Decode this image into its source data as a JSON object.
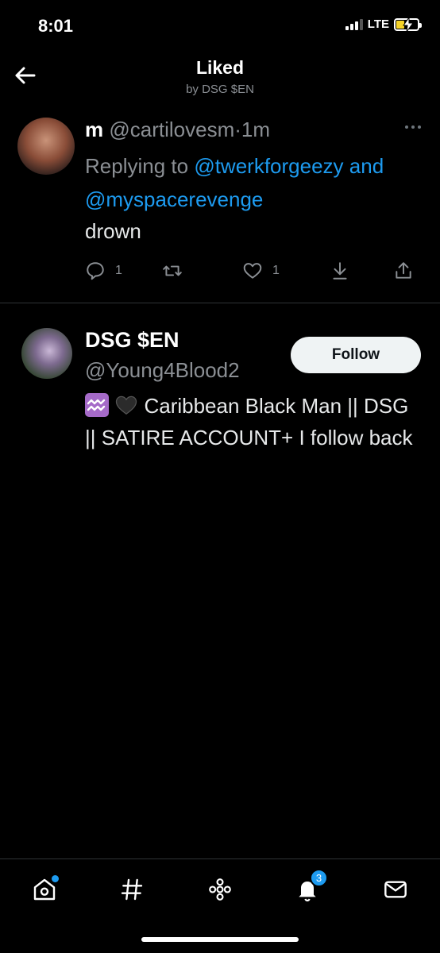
{
  "status_bar": {
    "time": "8:01",
    "network": "LTE"
  },
  "header": {
    "title": "Liked",
    "subtitle": "by DSG $EN"
  },
  "tweet": {
    "name": "m",
    "handle": "@cartilovesm",
    "separator": "·",
    "time": "1m",
    "replying_prefix": "Replying to ",
    "mention_1": "@twerkforgeezy",
    "and_word": " and ",
    "mention_2": "@myspacerevenge",
    "text": "drown",
    "reply_count": "1",
    "like_count": "1"
  },
  "user_card": {
    "name": "DSG $EN",
    "handle": "@Young4Blood2",
    "follow_label": "Follow",
    "bio": "Caribbean Black Man || DSG || SATIRE ACCOUNT+ I follow back"
  },
  "tab_bar": {
    "notifications_badge": "3"
  },
  "icons": {
    "back": "arrow-left-icon",
    "more": "more-dots-icon",
    "reply": "reply-icon",
    "retweet": "retweet-icon",
    "like": "heart-icon",
    "save": "download-icon",
    "share": "share-icon",
    "home": "home-icon",
    "explore": "hashtag-icon",
    "spaces": "spaces-icon",
    "notifications": "bell-icon",
    "messages": "mail-icon"
  },
  "colors": {
    "accent": "#1d9bf0",
    "background": "#000000",
    "muted": "#8b8f94"
  }
}
